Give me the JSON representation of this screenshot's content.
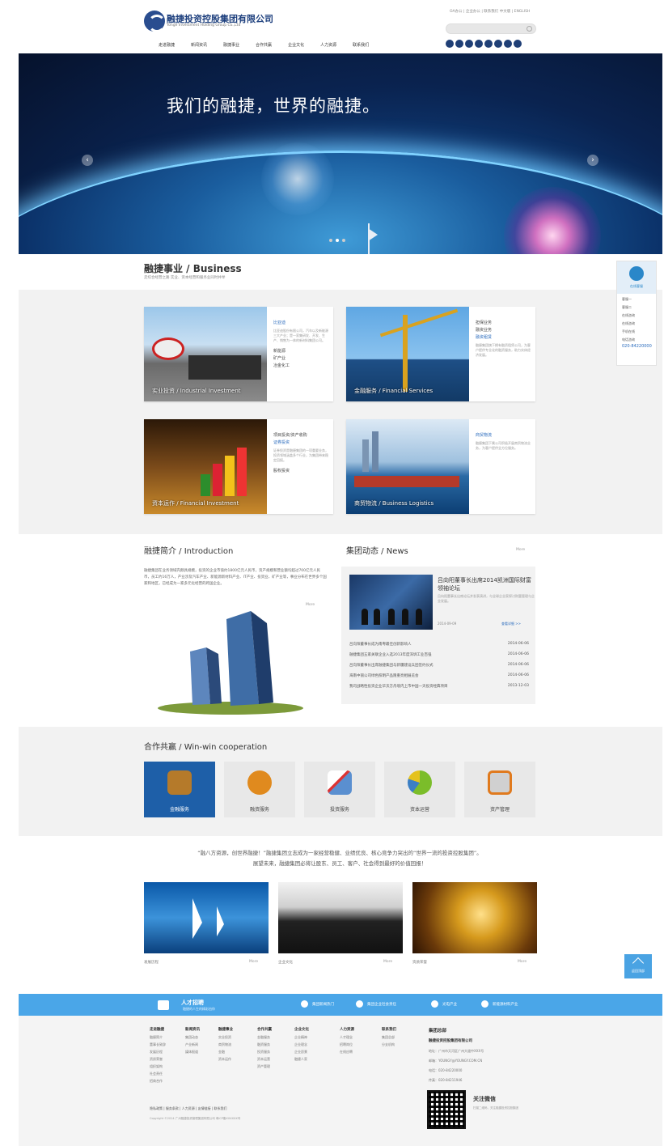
{
  "header": {
    "logo_cn": "融捷投资控股集团有限公司",
    "logo_en": "Yonge Investment Holding Group Co.,Ltd",
    "top_links": "OA办公 | 企业办公 | 联系我们 中文版 | ENGLISH",
    "nav": [
      "走进融捷",
      "新闻资讯",
      "融捷事业",
      "合作共赢",
      "企业文化",
      "人力资源",
      "联系我们"
    ]
  },
  "banner": {
    "slogan": "我们的融捷，世界的融捷。",
    "prev": "‹",
    "next": "›"
  },
  "business": {
    "title": "融捷事业 / Business",
    "subtitle": "走综合经营之路  实业、资本经营和服务业同时并举",
    "cards": [
      {
        "caption": "实业投资 / Industrial Investment",
        "items": [
          "比亚迪",
          "新能源",
          "矿产业",
          "冶金化工"
        ],
        "active": 0,
        "desc": "比亚迪股份有限公司，汽车以及新能源三大产业；是一家集研发、开发、生产、销售为一体的新材料集团公司。"
      },
      {
        "caption": "金融服务 / Financial Services",
        "items": [
          "担保业务",
          "融资业务",
          "融资租赁"
        ],
        "active": 2,
        "desc": "融捷集团旗下拥有融资租赁公司，为客户提供专业化的融资服务，助力实体经济发展。"
      },
      {
        "caption": "资本运作 / Financial Investment",
        "items": [
          "项目投资/资产收购",
          "证券投资",
          "股权投资"
        ],
        "active": 1,
        "desc": "证券投资是融捷集团的一项重要业务，投资领域涵盖多个行业，为集团带来稳定回报。"
      },
      {
        "caption": "商贸物流 / Business Logistics",
        "items": [
          "商贸物流"
        ],
        "active": 0,
        "desc": "融捷集团下属公司积极开展商贸物流业务，为客户提供全方位服务。"
      }
    ]
  },
  "kefu": {
    "label": "在线客服",
    "items": [
      "客服一",
      "客服二",
      "在线咨询",
      "在线咨询",
      "手机在线"
    ],
    "tel_label": "电话咨询",
    "tel": "020-84220000"
  },
  "intro": {
    "title": "融捷简介 / Introduction",
    "text": "融捷集团在业务领域内颇具规模，投资的企业市值约1800亿元人民币，资产规模和营业额均超过700亿元人民币，员工约16万人，产业涉及汽车产业、新能源新材料产业、IT产业、投资业、矿产业等，事业分布在世界多个国家和地区，已经成为一家多元化经营的跨国企业。",
    "more": "More"
  },
  "news": {
    "title": "集团动态 / News",
    "more": "More",
    "headline": "吕向阳董事长出席2014凯洲国际财富领袖论坛",
    "desc": "吕向阳董事长出席论坛并发表演讲，与全球企业家探讨财富管理与企业发展。",
    "date": "2014-09-09",
    "detail": "查看详细 >>",
    "items": [
      {
        "t": "吕向阳董事长成为南粤最佳创新影响人",
        "d": "2014-06-06"
      },
      {
        "t": "融捷集团五家关联企业入选2013年度深圳工业百强",
        "d": "2014-06-06"
      },
      {
        "t": "吕向阳董事长出席融捷集团与新疆建设兵团签约仪式",
        "d": "2014-06-06"
      },
      {
        "t": "海南中丽公司绿色照明产品隆重亮相展览会",
        "d": "2014-06-06"
      },
      {
        "t": "我司战略性投资企业华沃方舟境内上市中国一天投资经典项目",
        "d": "2013-12-03"
      }
    ]
  },
  "coop": {
    "title": "合作共赢 / Win-win cooperation",
    "items": [
      "金融服务",
      "融资服务",
      "投资服务",
      "资本运营",
      "资产管理"
    ],
    "active": 0
  },
  "slogan": [
    "“融八方资源，创世界融捷！”融捷集团立志成为一家经营稳健、业绩优良、核心竞争力突出的“世界一流的投资控股集团”。",
    "展望未来，融捷集团必将让股东、员工、客户、社会得到最好的价值回报！"
  ],
  "pictures": [
    {
      "label": "发展历程",
      "more": "More"
    },
    {
      "label": "企业文化",
      "more": "More"
    },
    {
      "label": "资质荣誉",
      "more": "More"
    }
  ],
  "totop": "返回顶部",
  "footer_bar": {
    "job_title": "人才招聘",
    "job_sub": "融捷的人生的精彩由你",
    "links": [
      "集团新闻热门",
      "集团企业社会责任",
      "光电产业",
      "新能源材料产业"
    ]
  },
  "footer_cols": [
    {
      "title": "走进融捷",
      "items": [
        "融捷简介",
        "董事长致辞",
        "发展历程",
        "资质荣誉",
        "组织架构",
        "社会责任",
        "招商合作"
      ]
    },
    {
      "title": "新闻资讯",
      "items": [
        "集团动态",
        "产业新闻",
        "媒体报道"
      ]
    },
    {
      "title": "融捷事业",
      "items": [
        "实业投资",
        "商贸物流",
        "金融",
        "资本运作"
      ]
    },
    {
      "title": "合作共赢",
      "items": [
        "金融服务",
        "融资服务",
        "投资服务",
        "资本运营",
        "资产管理"
      ]
    },
    {
      "title": "企业文化",
      "items": [
        "企业精神",
        "企业理念",
        "企业愿景",
        "融捷人家"
      ]
    },
    {
      "title": "人力资源",
      "items": [
        "人才理念",
        "招聘岗位",
        "在线应聘"
      ]
    },
    {
      "title": "联系我们",
      "items": [
        "集团总部",
        "分支机构"
      ]
    }
  ],
  "footer_links": "隐私政策 | 服务条款 | 人力资源 | 友情链接 | 联系我们",
  "copyright": "Copyright ©2014 广州融捷投资管理集团有限公司 粤ICP备XXXXXX号",
  "hq": {
    "title": "集团总部",
    "company": "融捷投资控股集团有限公司",
    "addr": "地址：广州市天河区广州大道中XXX号",
    "email": "邮箱：YOUNGY@YOUNGY.COM.CN",
    "tel": "电话：020-84220000",
    "fax": "传真：020-84211946"
  },
  "wechat": {
    "title": "关注微信",
    "sub": "扫描二维码，关注融捷投资控股集团"
  }
}
